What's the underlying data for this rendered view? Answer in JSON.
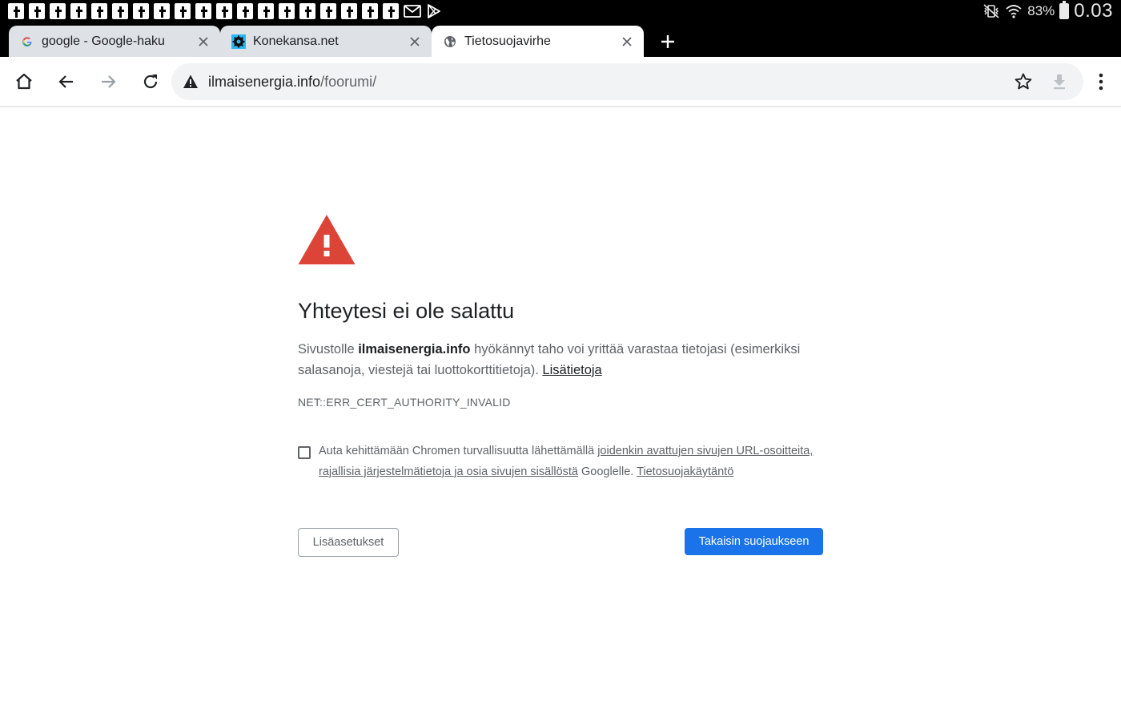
{
  "statusbar": {
    "notification_icons": [
      "facebook-icon",
      "facebook-icon",
      "facebook-icon",
      "facebook-icon",
      "facebook-icon",
      "facebook-icon",
      "facebook-icon",
      "facebook-icon",
      "facebook-icon",
      "facebook-icon",
      "facebook-icon",
      "facebook-icon",
      "facebook-icon",
      "facebook-icon",
      "facebook-icon",
      "facebook-icon",
      "facebook-icon",
      "facebook-icon",
      "facebook-icon",
      "gmail-icon",
      "play-store-icon"
    ],
    "battery_percent": "83%",
    "time": "0.03"
  },
  "tabs": [
    {
      "label": "google - Google-haku",
      "icon": "google-icon",
      "active": false
    },
    {
      "label": "Konekansa.net",
      "icon": "konekansa-icon",
      "active": false
    },
    {
      "label": "Tietosuojavirhe",
      "icon": "globe-icon",
      "active": true
    }
  ],
  "omnibox": {
    "host": "ilmaisenergia.info",
    "path": "/foorumi/"
  },
  "interstitial": {
    "heading": "Yhteytesi ei ole salattu",
    "body_prefix": "Sivustolle ",
    "body_host": "ilmaisenergia.info",
    "body_suffix": " hyökännyt taho voi yrittää varastaa tietojasi (esimerkiksi salasanoja, viestejä tai luottokorttitietoja). ",
    "learn_more_link": "Lisätietoja",
    "error_code": "NET::ERR_CERT_AUTHORITY_INVALID",
    "optin_prefix": "Auta kehittämään Chromen turvallisuutta lähettämällä ",
    "optin_link": "joidenkin avattujen sivujen URL-osoitteita, rajallisia järjestelmätietoja ja osia sivujen sisällöstä",
    "optin_middle": " Googlelle. ",
    "privacy_link": "Tietosuojakäytäntö",
    "optin_checked": false,
    "advanced_button": "Lisäasetukset",
    "back_button": "Takaisin suojaukseen"
  },
  "colors": {
    "warning_red": "#db4437",
    "primary_blue": "#1a73e8",
    "tab_inactive": "#dee1e6",
    "chrome_black": "#000000"
  }
}
